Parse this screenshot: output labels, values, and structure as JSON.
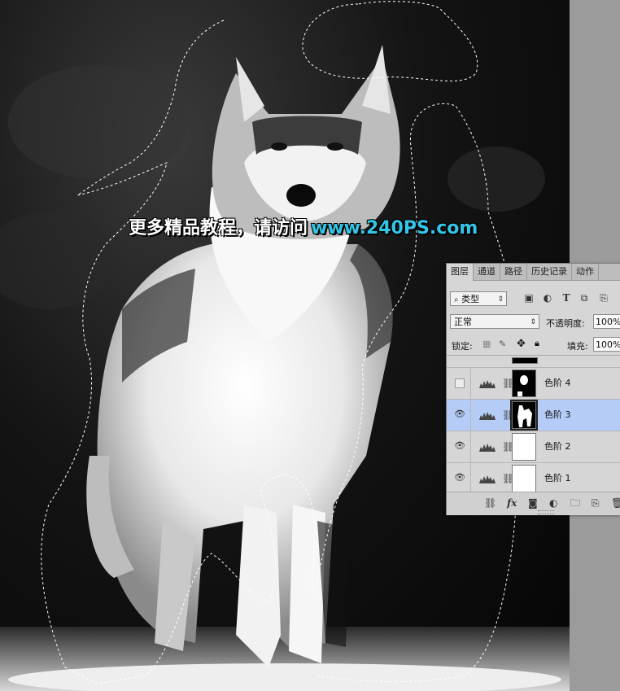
{
  "watermark": {
    "text_cn": "更多精品教程，请访问",
    "text_url": "www.240PS.com"
  },
  "layers_panel": {
    "tabs": [
      {
        "label": "图层",
        "active": true
      },
      {
        "label": "通道",
        "active": false
      },
      {
        "label": "路径",
        "active": false
      },
      {
        "label": "历史记录",
        "active": false
      },
      {
        "label": "动作",
        "active": false
      }
    ],
    "filter": {
      "search_icon": "search-icon",
      "kind_label": "类型",
      "icons": [
        "image-filter-icon",
        "adjustment-filter-icon",
        "type-filter-icon",
        "shape-filter-icon",
        "smart-object-filter-icon"
      ]
    },
    "blend": {
      "mode": "正常",
      "opacity_label": "不透明度:",
      "opacity_value": "100%"
    },
    "lock": {
      "label": "锁定:",
      "fill_label": "填充:",
      "fill_value": "100%"
    },
    "layers": [
      {
        "name": "色阶 4",
        "visible": false,
        "selected": false,
        "mask": "dark-small"
      },
      {
        "name": "色阶 3",
        "visible": true,
        "selected": true,
        "mask": "dark-wolf"
      },
      {
        "name": "色阶 2",
        "visible": true,
        "selected": false,
        "mask": "white"
      },
      {
        "name": "色阶 1",
        "visible": true,
        "selected": false,
        "mask": "white"
      }
    ],
    "footer_icons": [
      "link-layers-icon",
      "fx-icon",
      "add-mask-icon",
      "new-adjustment-icon",
      "new-group-icon",
      "new-layer-icon",
      "delete-icon"
    ],
    "footer_fx": "fx"
  },
  "colors": {
    "selected_layer": "#b5ccf6",
    "watermark_url": "#34c6e8",
    "panel_bg": "#d6d6d6"
  }
}
